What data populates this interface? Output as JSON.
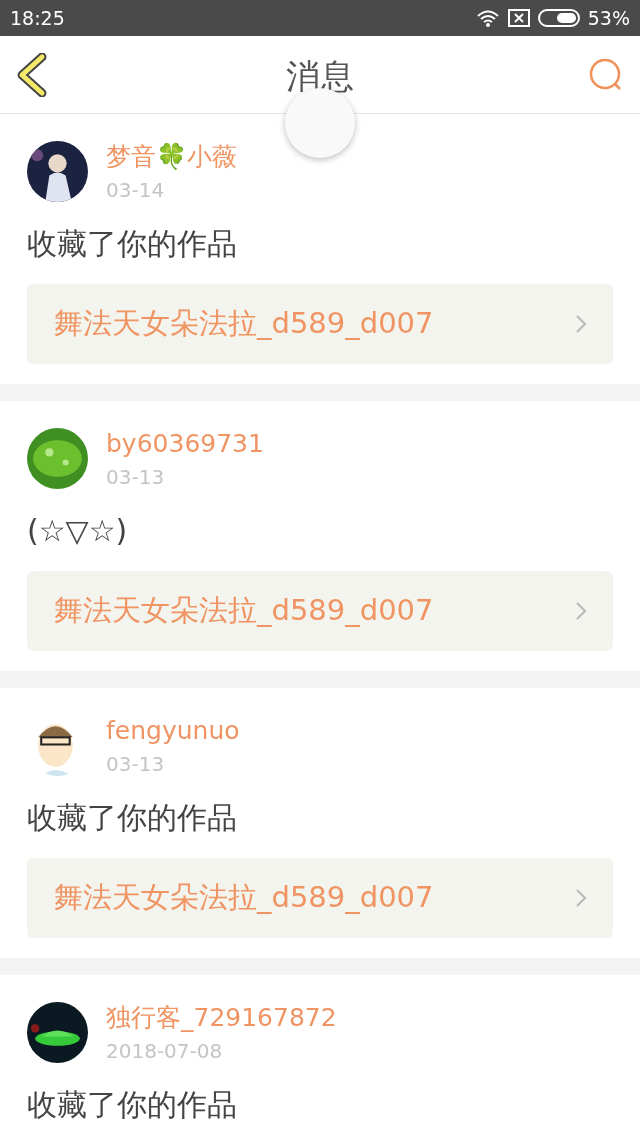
{
  "status_bar": {
    "time": "18:25",
    "battery": "53%"
  },
  "header": {
    "title": "消息"
  },
  "messages": [
    {
      "user": "梦音🍀小薇",
      "date": "03-14",
      "text": "收藏了你的作品",
      "work": "舞法天女朵法拉_d589_d007"
    },
    {
      "user": "by60369731",
      "date": "03-13",
      "text": "(☆▽☆)",
      "work": "舞法天女朵法拉_d589_d007"
    },
    {
      "user": "fengyunuo",
      "date": "03-13",
      "text": "收藏了你的作品",
      "work": "舞法天女朵法拉_d589_d007"
    },
    {
      "user": "独行客_729167872",
      "date": "2018-07-08",
      "text": "收藏了你的作品"
    }
  ]
}
